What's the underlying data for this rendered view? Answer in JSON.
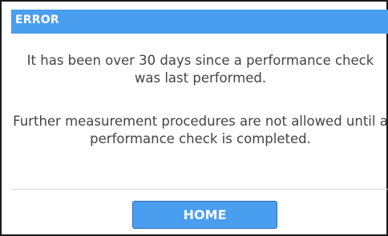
{
  "dialog": {
    "title": "ERROR",
    "message_1": "It has been over 30 days since a performance check was last performed.",
    "message_2": "Further measurement procedures are not allowed until a performance check is completed.",
    "home_button_label": "HOME"
  },
  "colors": {
    "title_bar": "#4a9ef0",
    "button": "#4a9ef0",
    "text": "#444444",
    "border": "#1a1a1a"
  }
}
